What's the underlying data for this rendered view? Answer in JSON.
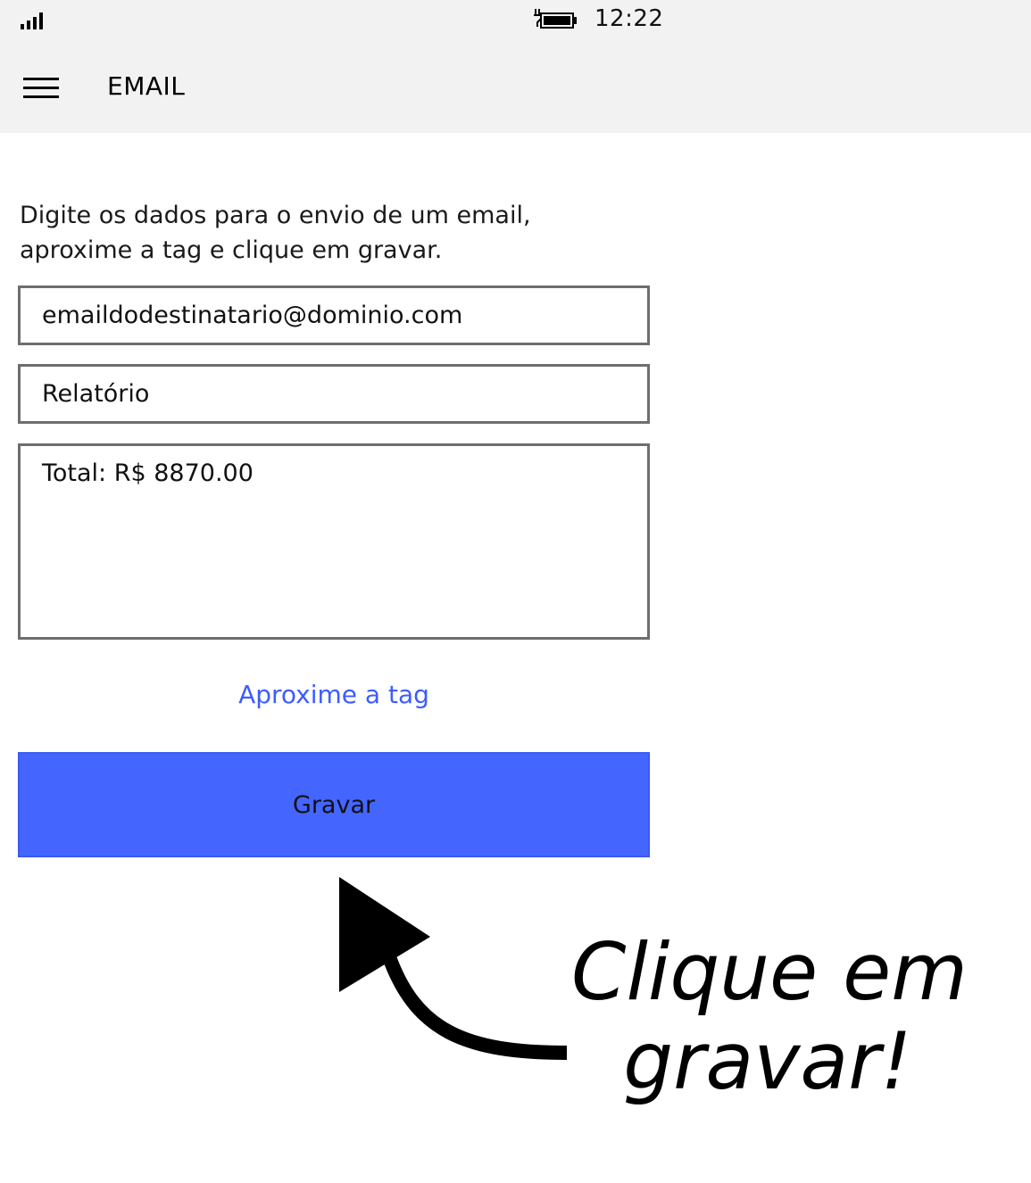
{
  "status_bar": {
    "signal_icon": "signal-icon",
    "battery_icon": "battery-charging-icon",
    "time": "12:22"
  },
  "header": {
    "menu_icon": "hamburger-menu-icon",
    "title": "EMAIL"
  },
  "form": {
    "instructions_line1": "Digite os dados para o envio de um email,",
    "instructions_line2": "aproxime a tag e clique em gravar.",
    "email_value": "emaildodestinatario@dominio.com",
    "subject_value": "Relatório",
    "body_value": "Total: R$ 8870.00",
    "tag_link_label": "Aproxime a tag",
    "save_label": "Gravar"
  },
  "annotation": {
    "line1": "Clique em",
    "line2": "gravar!",
    "arrow_icon": "curved-arrow-up-icon"
  },
  "colors": {
    "accent": "#4466ff",
    "link": "#3d5cff",
    "header_bg": "#f2f2f2"
  }
}
